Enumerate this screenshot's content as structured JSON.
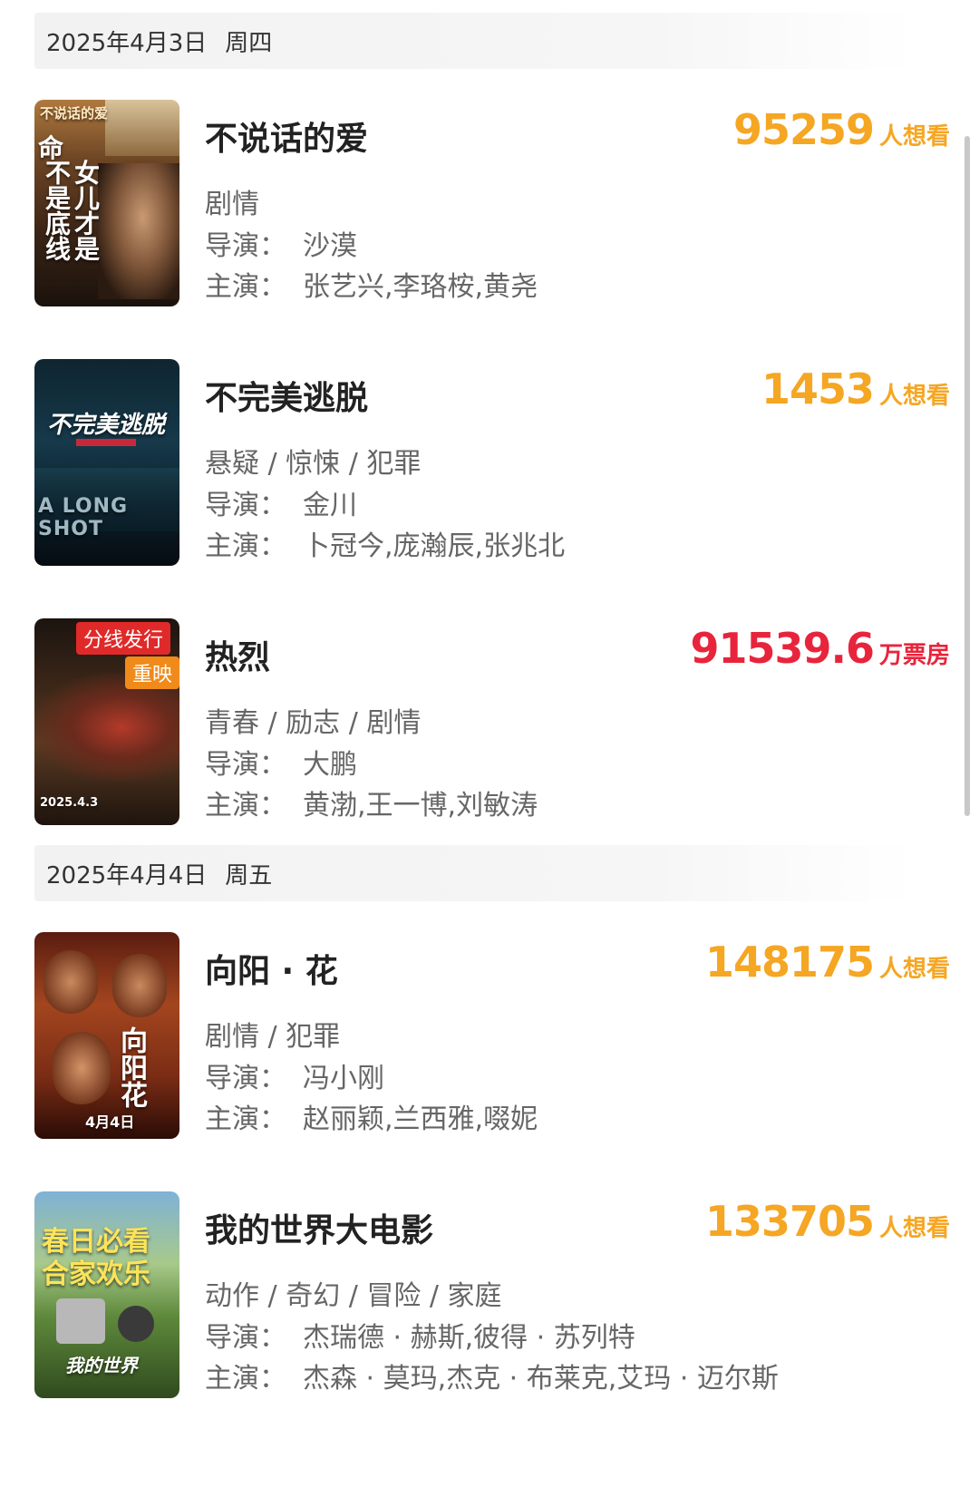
{
  "sections": [
    {
      "date": "2025年4月3日",
      "weekday": "周四",
      "movies": [
        {
          "title": "不说话的爱",
          "stat_value": "95259",
          "stat_unit": "人想看",
          "genre": "剧情",
          "director_label": "导演：",
          "director": "沙漠",
          "cast_label": "主演：",
          "cast": "张艺兴,李珞桉,黄尧",
          "poster_text_1": "不说话的爱",
          "poster_text_2": "命",
          "poster_text_3": "不是底线",
          "poster_text_4": "女儿才是"
        },
        {
          "title": "不完美逃脱",
          "stat_value": "1453",
          "stat_unit": "人想看",
          "genre": "悬疑 / 惊悚 / 犯罪",
          "director_label": "导演：",
          "director": "金川",
          "cast_label": "主演：",
          "cast": "卜冠今,庞瀚辰,张兆北",
          "poster_text_1": "不完美逃脱",
          "poster_text_2": "A LONG SHOT"
        },
        {
          "title": "热烈",
          "stat_value": "91539.6",
          "stat_unit": "万票房",
          "genre": "青春 / 励志 / 剧情",
          "director_label": "导演：",
          "director": "大鹏",
          "cast_label": "主演：",
          "cast": "黄渤,王一博,刘敏涛",
          "badge_1": "分线发行",
          "badge_2": "重映",
          "poster_text_1": "2025.4.3"
        }
      ]
    },
    {
      "date": "2025年4月4日",
      "weekday": "周五",
      "movies": [
        {
          "title": "向阳 · 花",
          "stat_value": "148175",
          "stat_unit": "人想看",
          "genre": "剧情 / 犯罪",
          "director_label": "导演：",
          "director": "冯小刚",
          "cast_label": "主演：",
          "cast": "赵丽颖,兰西雅,啜妮",
          "poster_text_1": "向阳花",
          "poster_text_2": "4月4日"
        },
        {
          "title": "我的世界大电影",
          "stat_value": "133705",
          "stat_unit": "人想看",
          "genre": "动作 / 奇幻 / 冒险 / 家庭",
          "director_label": "导演：",
          "director": "杰瑞德 · 赫斯,彼得 · 苏列特",
          "cast_label": "主演：",
          "cast": "杰森 · 莫玛,杰克 · 布莱克,艾玛 · 迈尔斯",
          "poster_text_1": "春日必看",
          "poster_text_2": "合家欢乐",
          "poster_text_3": "我的世界"
        }
      ]
    }
  ],
  "colors": {
    "want_to_see": "#f5a623",
    "box_office": "#e8243c"
  }
}
